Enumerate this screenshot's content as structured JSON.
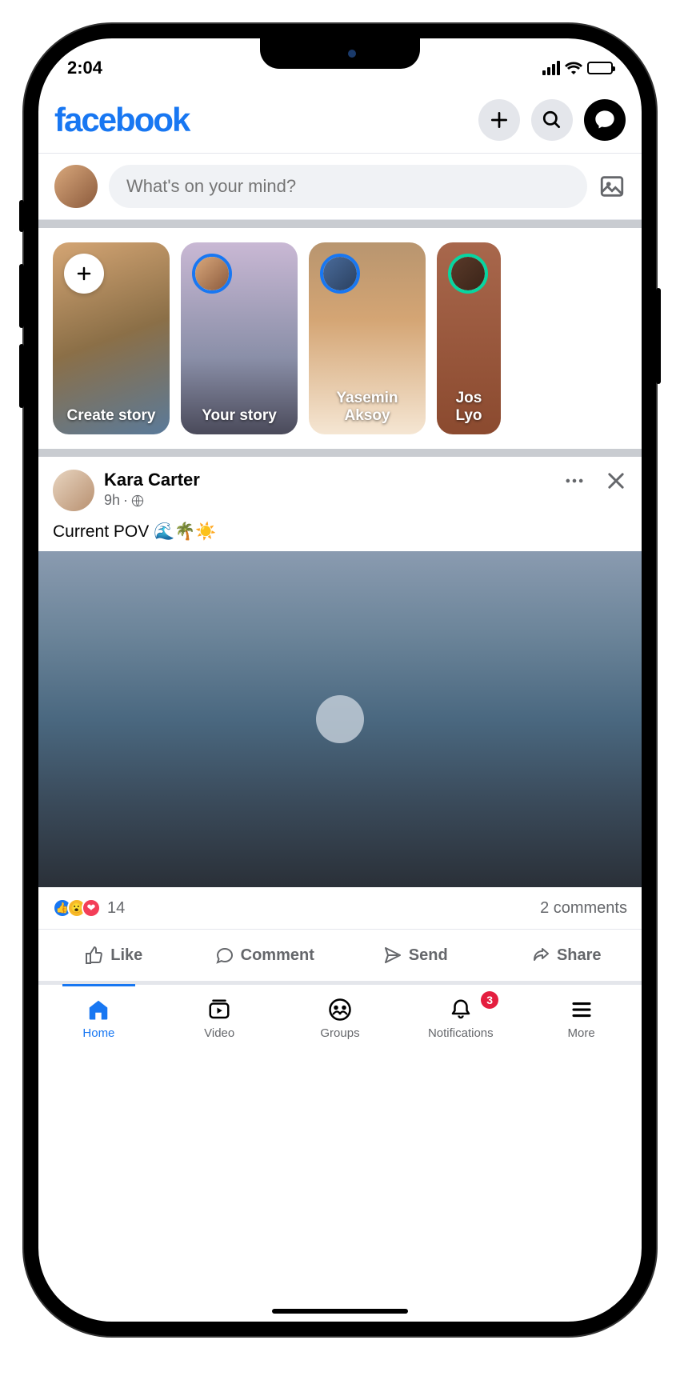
{
  "statusBar": {
    "time": "2:04"
  },
  "header": {
    "logo": "facebook"
  },
  "composer": {
    "placeholder": "What's on your mind?"
  },
  "stories": [
    {
      "label": "Create story",
      "badge": "plus",
      "bg": "story-bg1"
    },
    {
      "label": "Your story",
      "badge": "ring",
      "bg": "story-bg2"
    },
    {
      "label": "Yasemin Aksoy",
      "badge": "ring",
      "bg": "story-bg3"
    },
    {
      "label": "Jos\nLyo",
      "badge": "ring-green",
      "bg": "story-bg4"
    }
  ],
  "post": {
    "author": "Kara Carter",
    "time": "9h",
    "caption": "Current POV 🌊🌴☀️",
    "reactionCount": "14",
    "commentsText": "2 comments",
    "actions": {
      "like": "Like",
      "comment": "Comment",
      "send": "Send",
      "share": "Share"
    }
  },
  "bottomNav": {
    "home": "Home",
    "video": "Video",
    "groups": "Groups",
    "notifications": "Notifications",
    "more": "More",
    "notifBadge": "3"
  }
}
